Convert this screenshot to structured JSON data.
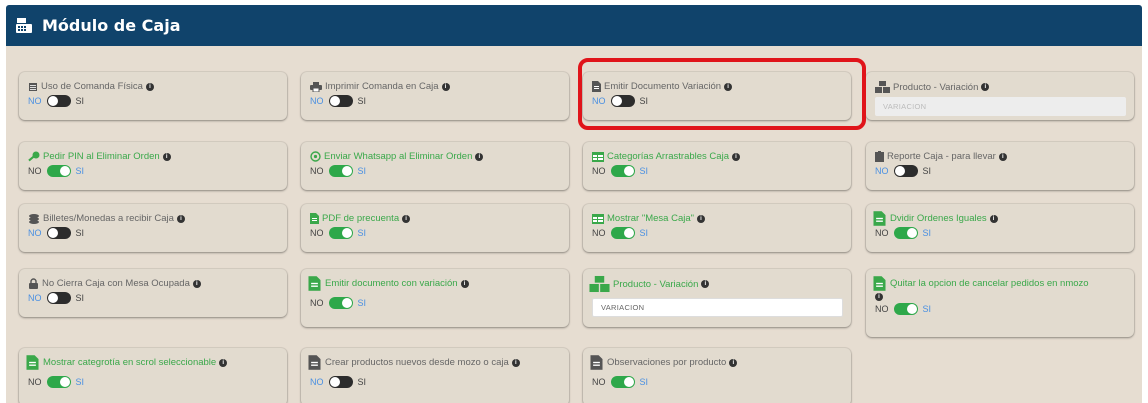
{
  "header": {
    "title": "Módulo de Caja"
  },
  "switch_labels": {
    "no": "NO",
    "si": "SI"
  },
  "cards": [
    {
      "label": "Uso de Comanda Física",
      "icon": "list-icon",
      "state": "off"
    },
    {
      "label": "Imprimir Comanda en Caja",
      "icon": "printer-icon",
      "state": "off"
    },
    {
      "label": "Emitir Documento Variación",
      "icon": "document-icon",
      "state": "off"
    },
    {
      "label": "Producto - Variación",
      "icon": "boxes-icon",
      "input_value": "VARIACION",
      "input_disabled": true
    },
    {
      "label": "Pedir PIN al Eliminar Orden",
      "icon": "key-icon",
      "state": "on"
    },
    {
      "label": "Enviar Whatsapp al Eliminar Orden",
      "icon": "whatsapp-icon",
      "state": "on"
    },
    {
      "label": "Categorías Arrastrables Caja",
      "icon": "table-icon",
      "state": "on"
    },
    {
      "label": "Reporte Caja - para llevar",
      "icon": "clipboard-icon",
      "state": "off"
    },
    {
      "label": "Billetes/Monedas a recibir Caja",
      "icon": "coins-icon",
      "state": "off"
    },
    {
      "label": "PDF de precuenta",
      "icon": "document-icon",
      "state": "on"
    },
    {
      "label": "Mostrar \"Mesa Caja\"",
      "icon": "table-icon",
      "state": "on"
    },
    {
      "label": "Dvidir Ordenes Iguales",
      "icon": "document-icon",
      "state": "on"
    },
    {
      "label": "No Cierra Caja con Mesa Ocupada",
      "icon": "lock-icon",
      "state": "off"
    },
    {
      "label": "Emitir documento con variación",
      "icon": "document-icon",
      "state": "on"
    },
    {
      "label": "Producto - Variación",
      "icon": "boxes-icon",
      "input_value": "VARIACION",
      "input_disabled": false
    },
    {
      "label": "Quitar la opcion de cancelar pedidos en nmozo",
      "icon": "document-icon",
      "state": "on"
    },
    {
      "label": "Mostrar categrotía en scrol seleccionable",
      "icon": "document-icon",
      "state": "on"
    },
    {
      "label": "Crear productos nuevos desde mozo o caja",
      "icon": "document-icon",
      "state": "off"
    },
    {
      "label": "Observaciones por producto",
      "icon": "document-icon",
      "state": "on"
    }
  ],
  "colors": {
    "header_bg": "#10436b",
    "panel_bg": "#e6ddd1",
    "toggle_on": "#2ea84a",
    "toggle_off": "#2c2c2c",
    "active_label": "#4a90e2",
    "green_text": "#3aa84a",
    "highlight": "#e0141a"
  }
}
